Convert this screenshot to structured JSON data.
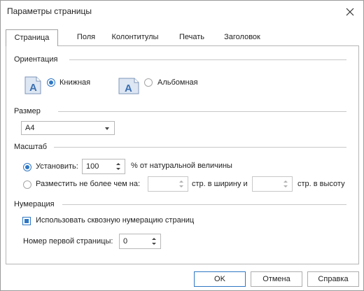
{
  "window": {
    "title": "Параметры страницы"
  },
  "tabs": [
    {
      "label": "Страница"
    },
    {
      "label": "Поля"
    },
    {
      "label": "Колонтитулы"
    },
    {
      "label": "Печать"
    },
    {
      "label": "Заголовок"
    }
  ],
  "orientation": {
    "heading": "Ориентация",
    "portrait_label": "Книжная",
    "landscape_label": "Альбомная",
    "selected": "portrait",
    "icon_letter": "A"
  },
  "size": {
    "heading": "Размер",
    "selected": "A4"
  },
  "scale": {
    "heading": "Масштаб",
    "set_label": "Установить:",
    "set_value": "100",
    "percent_label": "% от натуральной величины",
    "fit_label": "Разместить не более чем на:",
    "fit_width_value": "",
    "width_suffix": "стр. в ширину и",
    "fit_height_value": "",
    "height_suffix": "стр. в высоту",
    "selected": "set"
  },
  "numbering": {
    "heading": "Нумерация",
    "continuous_label": "Использовать сквозную нумерацию страниц",
    "continuous_checked": true,
    "first_page_label": "Номер первой страницы:",
    "first_page_value": "0"
  },
  "buttons": {
    "ok": "OK",
    "cancel": "Отмена",
    "help": "Справка"
  },
  "colors": {
    "accent": "#2f78c4",
    "border": "#b6b6b6",
    "icon_fill": "#dde6f3"
  }
}
